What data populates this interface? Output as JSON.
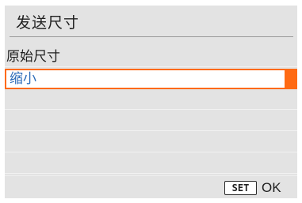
{
  "menu": {
    "title": "发送尺寸",
    "options": [
      {
        "label": "原始尺寸",
        "selected": false
      },
      {
        "label": "缩小",
        "selected": true
      },
      {
        "label": "",
        "selected": false
      },
      {
        "label": "",
        "selected": false
      },
      {
        "label": "",
        "selected": false
      },
      {
        "label": "",
        "selected": false
      }
    ]
  },
  "footer": {
    "set_label": "SET",
    "ok_label": "OK"
  },
  "colors": {
    "accent": "#ff6a13",
    "selected_text": "#2a6ab7",
    "background": "#e3e3e3"
  }
}
